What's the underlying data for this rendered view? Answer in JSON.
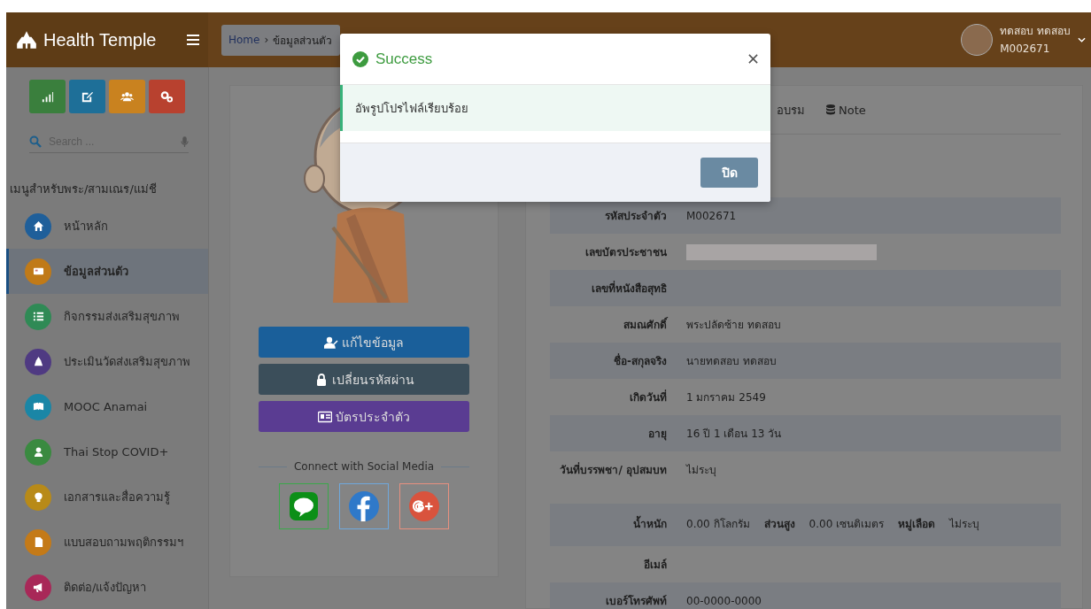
{
  "header": {
    "brand": "Health Temple",
    "breadcrumb": [
      "Home",
      "ข้อมูลส่วนตัว"
    ],
    "breadcrumb_separator": "›",
    "user": {
      "name": "ทดสอบ ทดสอบ",
      "id": "M002671"
    }
  },
  "sidebar": {
    "quick_buttons": [
      {
        "color": "#3a7f3d"
      },
      {
        "color": "#1e6f98"
      },
      {
        "color": "#c9821f"
      },
      {
        "color": "#b8412f"
      }
    ],
    "search": {
      "placeholder": "Search ..."
    },
    "heading": "เมนูสำหรับพระ/สามเณร/แม่ชี",
    "items": [
      {
        "label": "หน้าหลัก",
        "color": "#1f5f9a",
        "selected": false
      },
      {
        "label": "ข้อมูลส่วนตัว",
        "color": "#c07a18",
        "selected": true
      },
      {
        "label": "กิจกรรมส่งเสริมสุขภาพ",
        "color": "#2f8a55",
        "selected": false
      },
      {
        "label": "ประเมินวัดส่งเสริมสุขภาพ",
        "color": "#4f3a82",
        "selected": false
      },
      {
        "label": "MOOC Anamai",
        "color": "#1a86a6",
        "selected": false
      },
      {
        "label": "Thai Stop COVID+",
        "color": "#3a8a40",
        "selected": false
      },
      {
        "label": "เอกสารและสื่อความรู้",
        "color": "#b88a18",
        "selected": false
      },
      {
        "label": "แบบสอบถามพฤติกรรมฯ",
        "color": "#c47a18",
        "selected": false
      },
      {
        "label": "ติดต่อ/แจ้งปัญหา",
        "color": "#a82858",
        "selected": false
      }
    ]
  },
  "profile_card": {
    "actions": [
      {
        "label": "แก้ไขข้อมูล",
        "color": "#1a5f9a"
      },
      {
        "label": "เปลี่ยนรหัสผ่าน",
        "color": "#3b4e5a"
      },
      {
        "label": "บัตรประจำตัว",
        "color": "#5a3c92"
      }
    ],
    "social_heading": "Connect with Social Media",
    "social": [
      {
        "kind": "line"
      },
      {
        "kind": "facebook"
      },
      {
        "kind": "google_plus"
      }
    ]
  },
  "details": {
    "tabs": [
      {
        "label": "อบรม",
        "has_icon": false
      },
      {
        "label": "Note",
        "has_icon": true
      }
    ],
    "rows": [
      {
        "kind": "text",
        "label": "รหัสประจำตัว",
        "value": "M002671"
      },
      {
        "kind": "redacted",
        "label": "เลขบัตรประชาชน"
      },
      {
        "kind": "empty",
        "label": "เลขที่หนังสือสุทธิ"
      },
      {
        "kind": "text",
        "label": "สมณศักดิ์",
        "value": "พระปลัดซ้าย ทดสอบ"
      },
      {
        "kind": "text",
        "label": "ชื่อ-สกุลจริง",
        "value": "นายทดสอบ ทดสอบ"
      },
      {
        "kind": "text",
        "label": "เกิดวันที่",
        "value": "1 มกราคม 2549"
      },
      {
        "kind": "text",
        "label": "อายุ",
        "value": "16 ปี 1 เดือน 13 วัน"
      },
      {
        "kind": "text",
        "label": "วันที่บรรพชา/ อุปสมบท",
        "value": "ไม่ระบุ"
      },
      {
        "kind": "measures",
        "label": "น้ำหนัก",
        "value": "0.00 กิโลกรัม",
        "extra": [
          {
            "label": "ส่วนสูง",
            "value": "0.00 เซนติเมตร"
          },
          {
            "label": "หมู่เลือด",
            "value": "ไม่ระบุ"
          }
        ]
      },
      {
        "kind": "empty",
        "label": "อีเมล์"
      },
      {
        "kind": "text",
        "label": "เบอร์โทรศัพท์",
        "value": "00-0000-0000"
      }
    ]
  },
  "modal": {
    "title": "Success",
    "message": "อัพรูปโปรไฟล์เรียบร้อย",
    "close_button": "ปิด"
  }
}
